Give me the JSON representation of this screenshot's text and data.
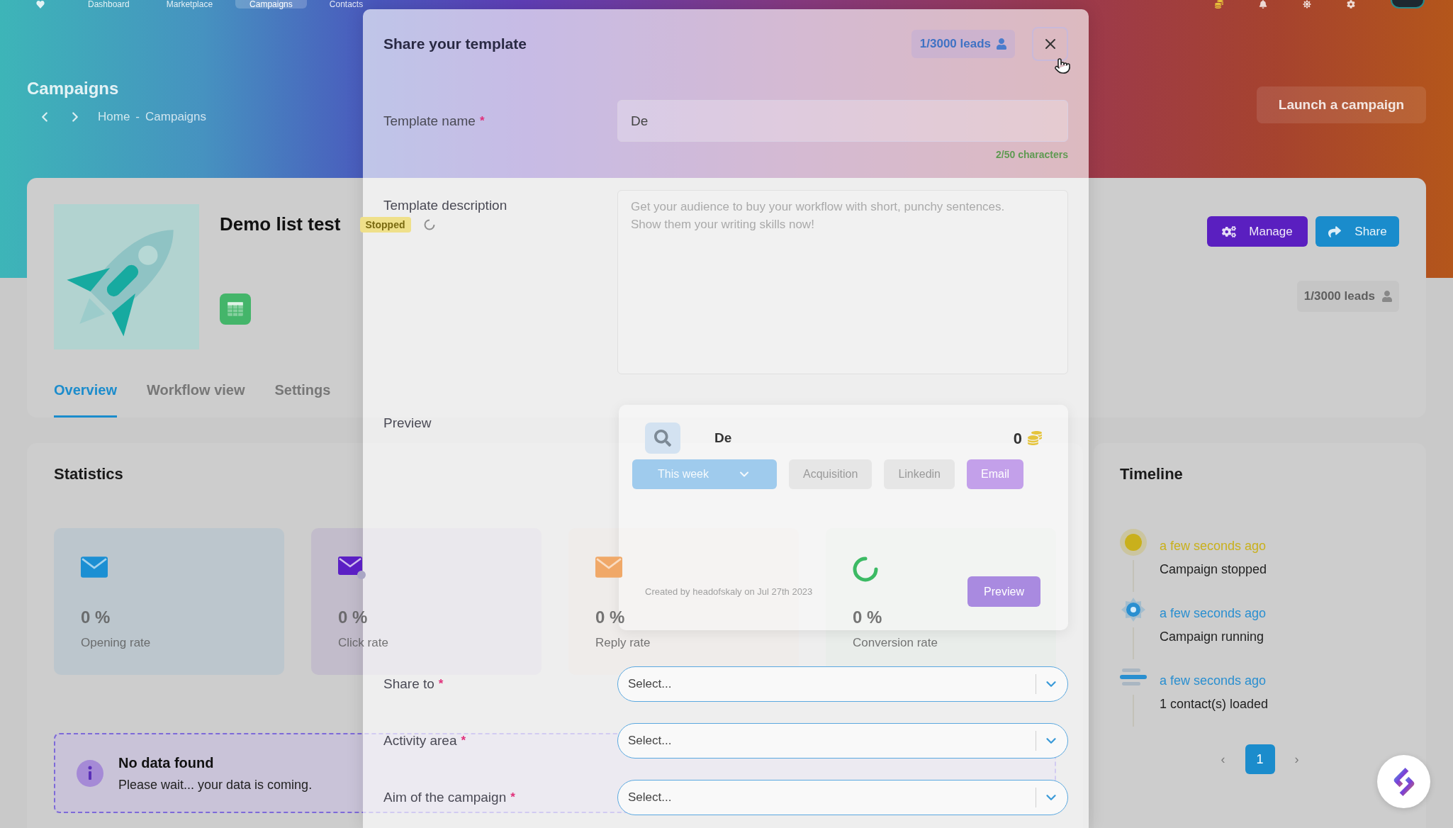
{
  "top_nav": {
    "items": [
      {
        "label": "Dashboard",
        "selected": false
      },
      {
        "label": "Marketplace",
        "selected": false
      },
      {
        "label": "Campaigns",
        "selected": true
      },
      {
        "label": "Contacts",
        "selected": false
      }
    ]
  },
  "header": {
    "title": "Campaigns",
    "breadcrumb": {
      "home": "Home",
      "separator": "-",
      "current": "Campaigns"
    },
    "launch_button": "Launch a campaign"
  },
  "campaign": {
    "title": "Demo list test",
    "status": {
      "kind": "stopped",
      "label": "Stopped"
    },
    "actions": [
      {
        "kind": "manage",
        "label": "Manage"
      },
      {
        "kind": "share",
        "label": "Share"
      }
    ],
    "leads": "1/3000 leads",
    "tabs": [
      {
        "label": "Overview",
        "selected": true
      },
      {
        "label": "Workflow view",
        "selected": false
      },
      {
        "label": "Settings",
        "selected": false
      }
    ]
  },
  "statistics": {
    "title": "Statistics",
    "tiles": [
      {
        "kind": "mail",
        "color": "#1b8fd3",
        "value": "0 %",
        "label": "Opening rate"
      },
      {
        "kind": "mail_dot",
        "color": "#5b1fc4",
        "value": "0 %",
        "label": "Click rate"
      },
      {
        "kind": "mail",
        "color": "#f0a868",
        "value": "0 %",
        "label": "Reply rate"
      },
      {
        "kind": "loader",
        "color": "#3cba64",
        "value": "0 %",
        "label": "Conversion rate"
      }
    ],
    "alert": {
      "title": "No data found",
      "message": "Please wait... your data is coming."
    }
  },
  "timeline": {
    "title": "Timeline",
    "events": [
      {
        "kind": "glow",
        "color": "#c9b01c",
        "time": "a few seconds ago",
        "text": "Campaign stopped"
      },
      {
        "kind": "gear",
        "color": "#2a8fd0",
        "time": "a few seconds ago",
        "text": "Campaign running"
      },
      {
        "kind": "bars",
        "color": "#2a8fd0",
        "time": "a few seconds ago",
        "text": "1 contact(s) loaded"
      }
    ],
    "pagination": {
      "previous": "‹",
      "next": "›",
      "pages": [
        {
          "label": "1",
          "selected": true
        }
      ]
    }
  },
  "modal": {
    "title": "Share your template",
    "leads": "1/3000 leads",
    "fields": [
      {
        "kind": "text",
        "label": "Template name",
        "required_mark": "*",
        "value": "De",
        "counter": "2/50 characters"
      },
      {
        "kind": "textarea",
        "label": "Template description",
        "placeholder": "Get your audience to buy your workflow with short, punchy sentences. Show them your writing skills now!"
      },
      {
        "kind": "preview",
        "label": "Preview",
        "card": {
          "title": "De",
          "price": "0",
          "period": "This week",
          "tags": [
            {
              "label": "Acquisition",
              "selected": false
            },
            {
              "label": "Linkedin",
              "selected": false
            },
            {
              "label": "Email",
              "selected": true
            }
          ],
          "footer": "Created by headofskaly on Jul 27th 2023",
          "button": "Preview"
        }
      },
      {
        "kind": "select",
        "label": "Share to",
        "required_mark": "*",
        "placeholder": "Select..."
      },
      {
        "kind": "select",
        "label": "Activity area",
        "required_mark": "*",
        "placeholder": "Select..."
      },
      {
        "kind": "select",
        "label": "Aim of the campaign",
        "required_mark": "*",
        "placeholder": "Select..."
      }
    ]
  }
}
